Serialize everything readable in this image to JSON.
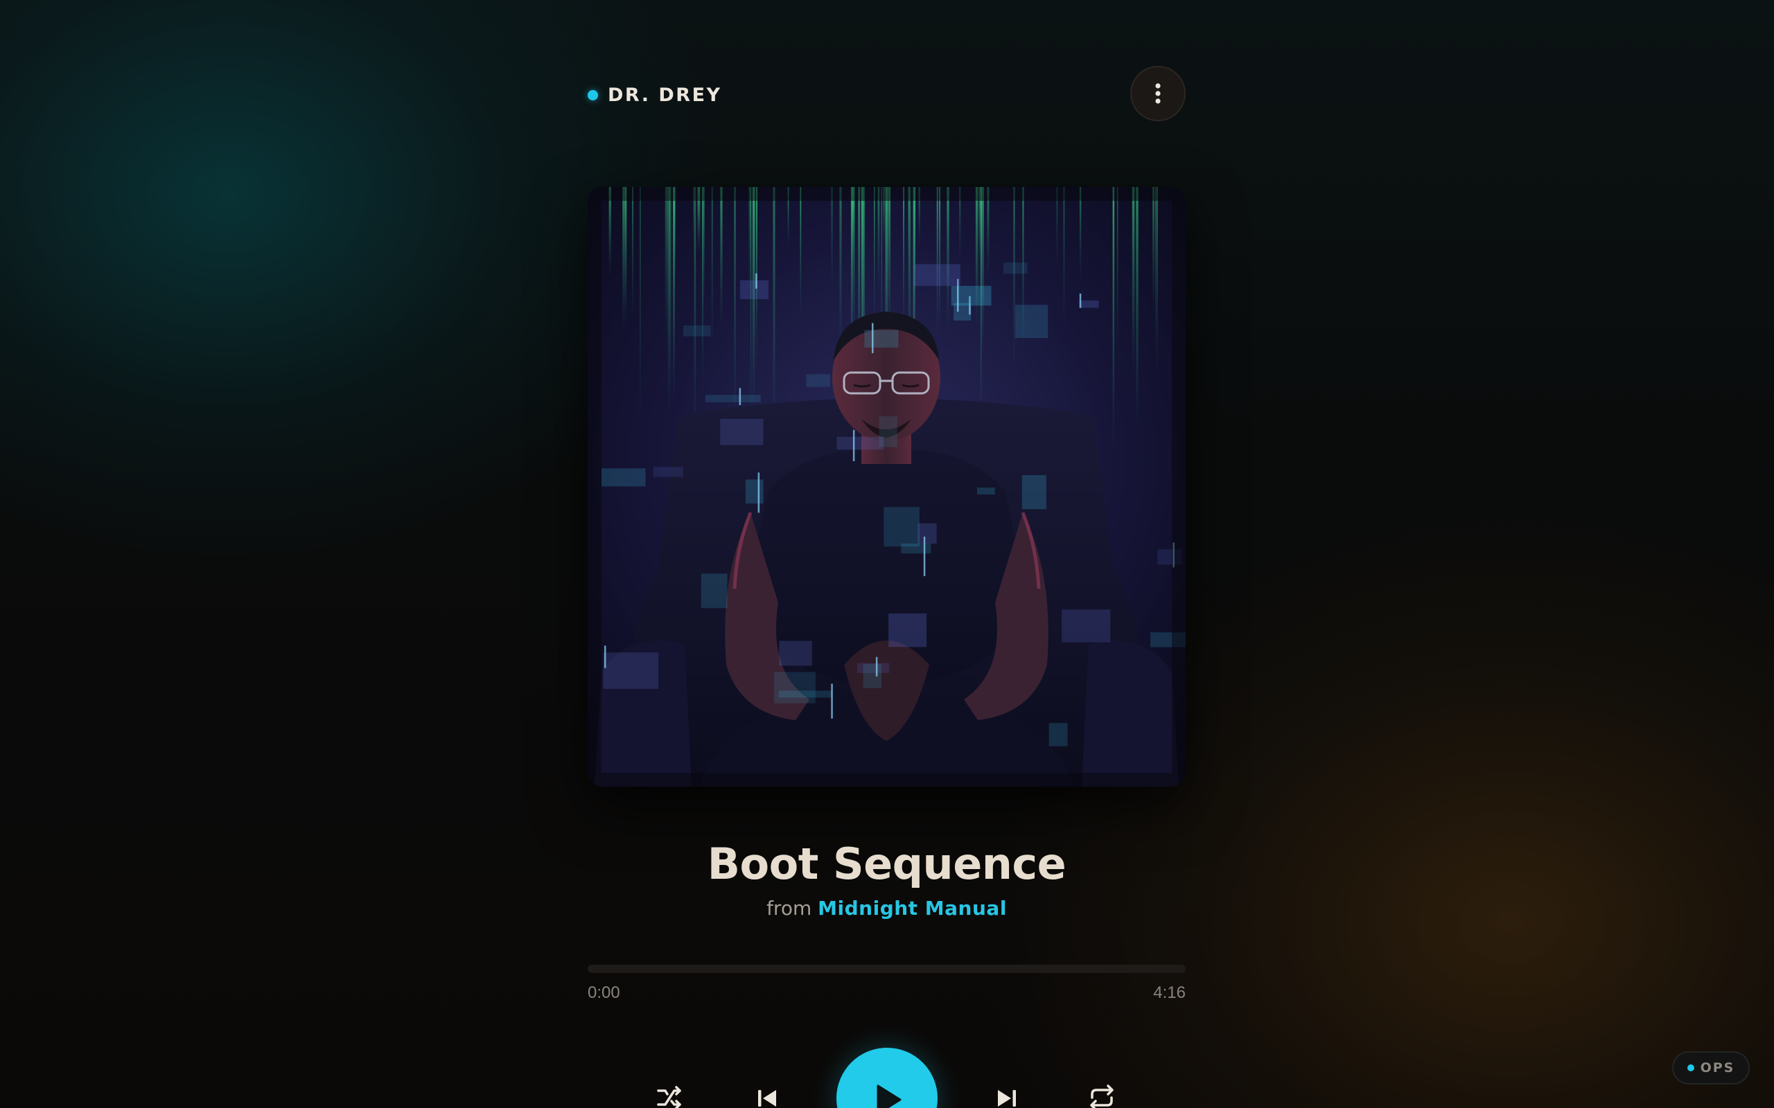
{
  "header": {
    "brand_name": "DR. DREY",
    "menu_icon": "more-vertical-icon"
  },
  "artwork": {
    "description_icon": "album-cover-image"
  },
  "track": {
    "title": "Boot Sequence",
    "from_label": "from",
    "album": "Midnight Manual"
  },
  "progress": {
    "current": "0:00",
    "total": "4:16",
    "fraction": 0
  },
  "controls": {
    "shuffle_icon": "shuffle-icon",
    "previous_icon": "skip-previous-icon",
    "play_icon": "play-icon",
    "next_icon": "skip-next-icon",
    "repeat_icon": "repeat-icon"
  },
  "badge": {
    "label": "OPS"
  },
  "colors": {
    "accent": "#22cbe9",
    "title": "#e7ddcf",
    "background": "#0a0908"
  }
}
